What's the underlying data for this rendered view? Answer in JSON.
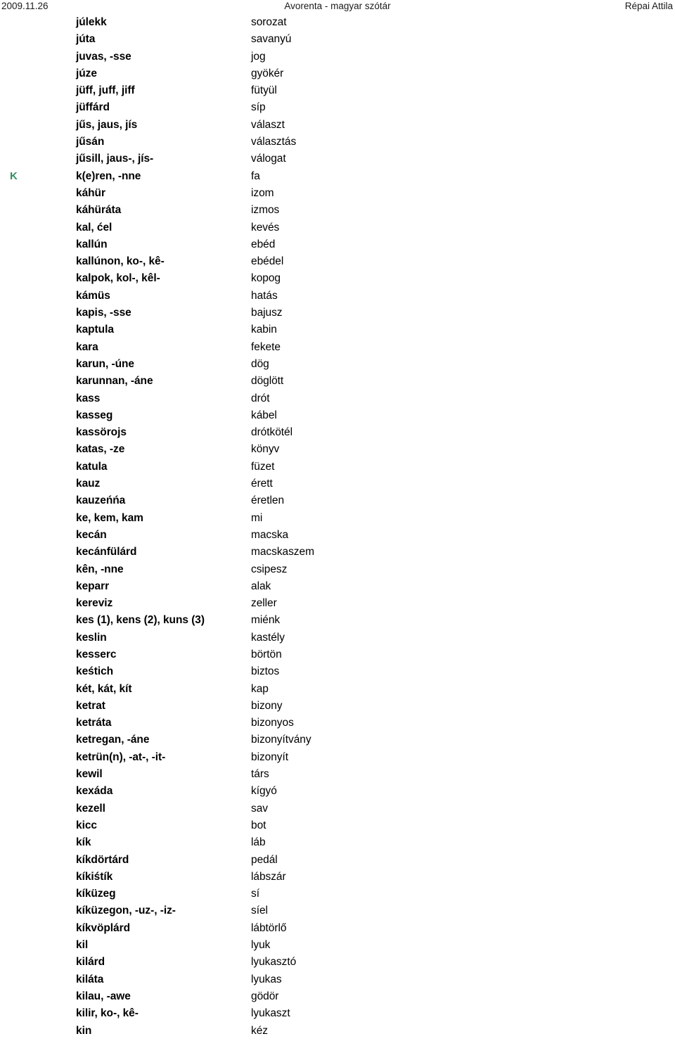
{
  "header": {
    "date": "2009.11.26",
    "title": "Avorenta - magyar szótár",
    "author": "Répai Attila"
  },
  "accent_color": "#2f8f63",
  "dictionary": {
    "entries": [
      {
        "letter": "",
        "head": "júlekk",
        "gloss": "sorozat"
      },
      {
        "letter": "",
        "head": "júta",
        "gloss": "savanyú"
      },
      {
        "letter": "",
        "head": "juvas, -sse",
        "gloss": "jog"
      },
      {
        "letter": "",
        "head": "júze",
        "gloss": "gyökér"
      },
      {
        "letter": "",
        "head": "jüff, juff, jiff",
        "gloss": "fütyül"
      },
      {
        "letter": "",
        "head": "jüffárd",
        "gloss": "síp"
      },
      {
        "letter": "",
        "head": "jűs, jaus, jís",
        "gloss": "választ"
      },
      {
        "letter": "",
        "head": "jűsán",
        "gloss": "választás"
      },
      {
        "letter": "",
        "head": "jűsill, jaus-, jís-",
        "gloss": "válogat"
      },
      {
        "letter": "K",
        "head": "k(e)ren, -nne",
        "gloss": "fa"
      },
      {
        "letter": "",
        "head": "káhür",
        "gloss": "izom"
      },
      {
        "letter": "",
        "head": "káhüráta",
        "gloss": "izmos"
      },
      {
        "letter": "",
        "head": "kal, ćel",
        "gloss": "kevés"
      },
      {
        "letter": "",
        "head": "kallún",
        "gloss": "ebéd"
      },
      {
        "letter": "",
        "head": "kallúnon, ko-, kê-",
        "gloss": "ebédel"
      },
      {
        "letter": "",
        "head": "kalpok, kol-, kêl-",
        "gloss": "kopog"
      },
      {
        "letter": "",
        "head": "kámüs",
        "gloss": "hatás"
      },
      {
        "letter": "",
        "head": "kapis, -sse",
        "gloss": "bajusz"
      },
      {
        "letter": "",
        "head": "kaptula",
        "gloss": "kabin"
      },
      {
        "letter": "",
        "head": "kara",
        "gloss": "fekete"
      },
      {
        "letter": "",
        "head": "karun, -úne",
        "gloss": "dög"
      },
      {
        "letter": "",
        "head": "karunnan, -áne",
        "gloss": "döglött"
      },
      {
        "letter": "",
        "head": "kass",
        "gloss": "drót"
      },
      {
        "letter": "",
        "head": "kasseg",
        "gloss": "kábel"
      },
      {
        "letter": "",
        "head": "kassörojs",
        "gloss": "drótkötél"
      },
      {
        "letter": "",
        "head": "katas, -ze",
        "gloss": "könyv"
      },
      {
        "letter": "",
        "head": "katula",
        "gloss": "füzet"
      },
      {
        "letter": "",
        "head": "kauz",
        "gloss": "érett"
      },
      {
        "letter": "",
        "head": "kauzeńńa",
        "gloss": "éretlen"
      },
      {
        "letter": "",
        "head": "ke, kem, kam",
        "gloss": "mi"
      },
      {
        "letter": "",
        "head": "kecán",
        "gloss": "macska"
      },
      {
        "letter": "",
        "head": "kecánfülárd",
        "gloss": "macskaszem"
      },
      {
        "letter": "",
        "head": "kên, -nne",
        "gloss": "csipesz"
      },
      {
        "letter": "",
        "head": "keparr",
        "gloss": "alak"
      },
      {
        "letter": "",
        "head": "kereviz",
        "gloss": "zeller"
      },
      {
        "letter": "",
        "head": "kes (1), kens (2), kuns (3)",
        "gloss": "miénk"
      },
      {
        "letter": "",
        "head": "keslin",
        "gloss": "kastély"
      },
      {
        "letter": "",
        "head": "kesserc",
        "gloss": "börtön"
      },
      {
        "letter": "",
        "head": "keśtich",
        "gloss": "biztos"
      },
      {
        "letter": "",
        "head": "két, kát, kít",
        "gloss": "kap"
      },
      {
        "letter": "",
        "head": "ketrat",
        "gloss": "bizony"
      },
      {
        "letter": "",
        "head": "ketráta",
        "gloss": "bizonyos"
      },
      {
        "letter": "",
        "head": "ketregan, -áne",
        "gloss": "bizonyítvány"
      },
      {
        "letter": "",
        "head": "ketrün(n), -at-, -it-",
        "gloss": "bizonyít"
      },
      {
        "letter": "",
        "head": "kewil",
        "gloss": "társ"
      },
      {
        "letter": "",
        "head": "kexáda",
        "gloss": "kígyó"
      },
      {
        "letter": "",
        "head": "kezell",
        "gloss": "sav"
      },
      {
        "letter": "",
        "head": "kicc",
        "gloss": "bot"
      },
      {
        "letter": "",
        "head": "kík",
        "gloss": "láb"
      },
      {
        "letter": "",
        "head": "kíkdörtárd",
        "gloss": "pedál"
      },
      {
        "letter": "",
        "head": "kíkiśtík",
        "gloss": "lábszár"
      },
      {
        "letter": "",
        "head": "kíküzeg",
        "gloss": "sí"
      },
      {
        "letter": "",
        "head": "kíküzegon, -uz-, -iz-",
        "gloss": "síel"
      },
      {
        "letter": "",
        "head": "kíkvöplárd",
        "gloss": "lábtörlő"
      },
      {
        "letter": "",
        "head": "kil",
        "gloss": "lyuk"
      },
      {
        "letter": "",
        "head": "kilárd",
        "gloss": "lyukasztó"
      },
      {
        "letter": "",
        "head": "kiláta",
        "gloss": "lyukas"
      },
      {
        "letter": "",
        "head": "kilau, -awe",
        "gloss": "gödör"
      },
      {
        "letter": "",
        "head": "kilir, ko-, kê-",
        "gloss": "lyukaszt"
      },
      {
        "letter": "",
        "head": "kin",
        "gloss": "kéz"
      }
    ]
  }
}
